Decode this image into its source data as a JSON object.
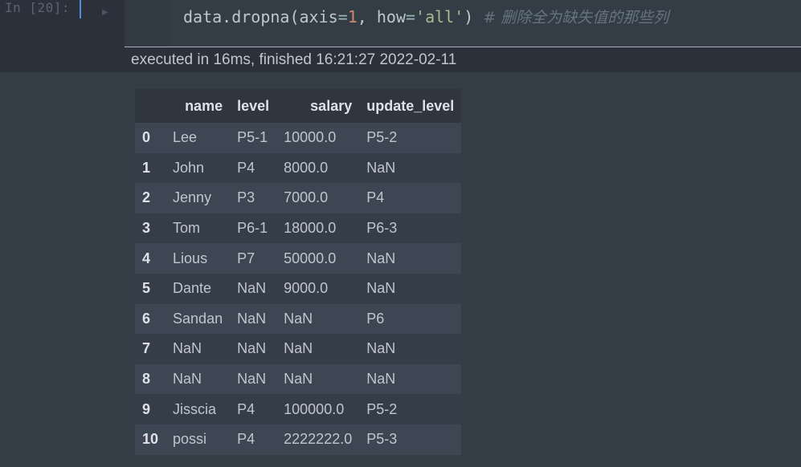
{
  "cell": {
    "prompt": "In [20]:",
    "code": {
      "fn": "data.dropna(",
      "arg1_name": "axis",
      "eq": "=",
      "arg1_value": "1",
      "sep": ", ",
      "arg2_name": "how",
      "arg2_value": "'all'",
      "close": ")",
      "comment": "# 删除全为缺失值的那些列"
    }
  },
  "execution": {
    "info": "executed in 16ms, finished 16:21:27 2022-02-11"
  },
  "table": {
    "columns": [
      "",
      "name",
      "level",
      "salary",
      "update_level"
    ],
    "rows": [
      {
        "index": "0",
        "name": "Lee",
        "level": "P5-1",
        "salary": "10000.0",
        "update_level": "P5-2"
      },
      {
        "index": "1",
        "name": "John",
        "level": "P4",
        "salary": "8000.0",
        "update_level": "NaN"
      },
      {
        "index": "2",
        "name": "Jenny",
        "level": "P3",
        "salary": "7000.0",
        "update_level": "P4"
      },
      {
        "index": "3",
        "name": "Tom",
        "level": "P6-1",
        "salary": "18000.0",
        "update_level": "P6-3"
      },
      {
        "index": "4",
        "name": "Lious",
        "level": "P7",
        "salary": "50000.0",
        "update_level": "NaN"
      },
      {
        "index": "5",
        "name": "Dante",
        "level": "NaN",
        "salary": "9000.0",
        "update_level": "NaN"
      },
      {
        "index": "6",
        "name": "Sandan",
        "level": "NaN",
        "salary": "NaN",
        "update_level": "P6"
      },
      {
        "index": "7",
        "name": "NaN",
        "level": "NaN",
        "salary": "NaN",
        "update_level": "NaN"
      },
      {
        "index": "8",
        "name": "NaN",
        "level": "NaN",
        "salary": "NaN",
        "update_level": "NaN"
      },
      {
        "index": "9",
        "name": "Jisscia",
        "level": "P4",
        "salary": "100000.0",
        "update_level": "P5-2"
      },
      {
        "index": "10",
        "name": "possi",
        "level": "P4",
        "salary": "2222222.0",
        "update_level": "P5-3"
      }
    ]
  },
  "colors": {
    "background": "#2b303b",
    "code_background": "#343d46",
    "accent_cursor": "#4a90d9"
  }
}
